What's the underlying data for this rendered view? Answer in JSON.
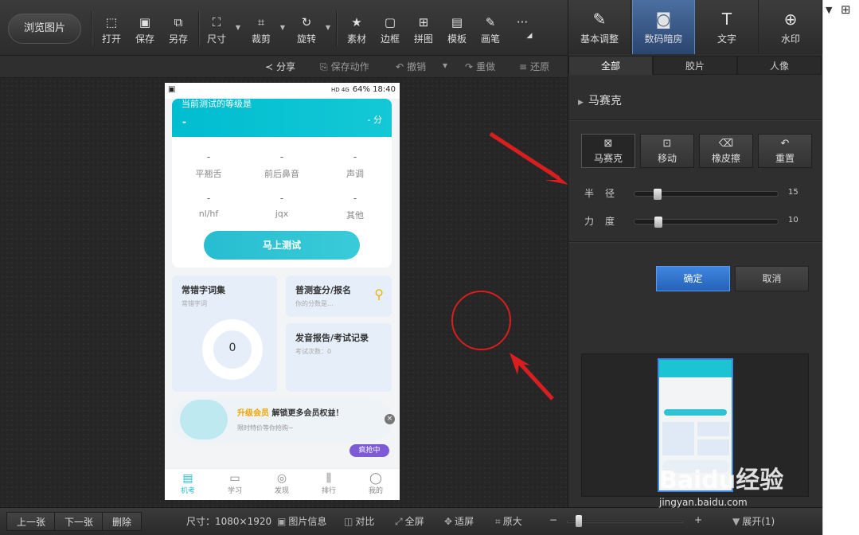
{
  "toolbar": {
    "browse": "浏览图片",
    "buttons": [
      {
        "label": "打开",
        "icon": "open-icon"
      },
      {
        "label": "保存",
        "icon": "save-icon"
      },
      {
        "label": "另存",
        "icon": "save-as-icon"
      },
      {
        "label": "尺寸",
        "icon": "resize-icon"
      },
      {
        "label": "裁剪",
        "icon": "crop-icon"
      },
      {
        "label": "旋转",
        "icon": "rotate-icon"
      },
      {
        "label": "素材",
        "icon": "material-icon"
      },
      {
        "label": "边框",
        "icon": "border-icon"
      },
      {
        "label": "拼图",
        "icon": "collage-icon"
      },
      {
        "label": "模板",
        "icon": "template-icon"
      },
      {
        "label": "画笔",
        "icon": "brush-icon"
      },
      {
        "label": "···",
        "icon": "more-icon"
      }
    ]
  },
  "subbar": {
    "share": "分享",
    "save_action": "保存动作",
    "undo": "撤销",
    "redo": "重做",
    "restore": "还原"
  },
  "phone": {
    "status_right": "64% 18:40",
    "status_icons": "HD 4G",
    "hero_title": "当前测试的等级是",
    "hero_dash": "-",
    "hero_score": "- 分",
    "stats": [
      {
        "value": "-",
        "name": "平翘舌"
      },
      {
        "value": "-",
        "name": "前后鼻音"
      },
      {
        "value": "-",
        "name": "声调"
      },
      {
        "value": "-",
        "name": "nl/hf"
      },
      {
        "value": "-",
        "name": "jqx"
      },
      {
        "value": "-",
        "name": "其他"
      }
    ],
    "test_button": "马上测试",
    "card1_title": "常错字词集",
    "card1_sub": "常错字词",
    "card1_count": "0",
    "card2_title": "普测查分/报名",
    "card2_sub": "你的分数是...",
    "card3_title": "发音报告/考试记录",
    "card3_sub": "考试次数：0",
    "vip_highlight": "升级会员",
    "vip_title": "解锁更多会员权益！",
    "vip_sub": "限时特价等你抢购~",
    "vip_badge": "疯抢中",
    "vip_close": "×",
    "tabs": [
      {
        "label": "机考",
        "icon": "exam-icon"
      },
      {
        "label": "学习",
        "icon": "book-icon"
      },
      {
        "label": "发现",
        "icon": "compass-icon"
      },
      {
        "label": "排行",
        "icon": "ranking-icon"
      },
      {
        "label": "我的",
        "icon": "profile-icon"
      }
    ]
  },
  "rpanel": {
    "tabs": [
      {
        "label": "基本调整",
        "icon": "adjust-icon"
      },
      {
        "label": "数码暗房",
        "icon": "darkroom-icon"
      },
      {
        "label": "文字",
        "icon": "text-icon"
      },
      {
        "label": "水印",
        "icon": "watermark-icon"
      }
    ],
    "subtabs": [
      "全部",
      "胶片",
      "人像"
    ],
    "section": "马赛克",
    "tools": [
      {
        "label": "马赛克",
        "icon": "mosaic-icon"
      },
      {
        "label": "移动",
        "icon": "move-icon"
      },
      {
        "label": "橡皮擦",
        "icon": "eraser-icon"
      },
      {
        "label": "重置",
        "icon": "reset-icon"
      }
    ],
    "radius_label": "半径",
    "radius_value": "15",
    "strength_label": "力度",
    "strength_value": "10",
    "ok": "确定",
    "cancel": "取消"
  },
  "bottom": {
    "prev": "上一张",
    "next": "下一张",
    "delete": "删除",
    "size": "尺寸：1080×1920",
    "info": "图片信息",
    "compare": "对比",
    "fullscreen": "全屏",
    "fit": "适屏",
    "original": "原大",
    "zoom_minus": "−",
    "zoom_plus": "+",
    "expand": "展开(1)"
  },
  "watermark": {
    "text": "Baidu经验",
    "url": "jingyan.baidu.com"
  },
  "colors": {
    "accent_blue": "#3f86e0",
    "teal": "#27bdd1",
    "annotation_red": "#d81e1e"
  }
}
